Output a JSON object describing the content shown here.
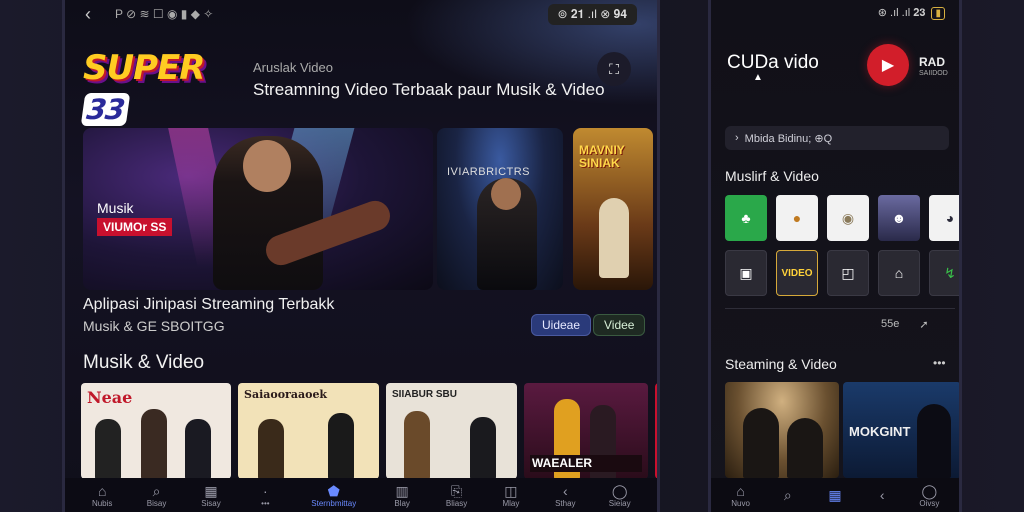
{
  "left": {
    "status": {
      "back_icon": "arrow-left-icon",
      "indicators": "P ⊘ ≋ ☐ ◉ ▮ ◆  ✧",
      "right_pill": "⊚ 𝟐𝟏 .ıl ⊗ 𝟗𝟒"
    },
    "header": {
      "logo_text": "SUPER",
      "logo_num": "33",
      "kicker": "Aruslak Video",
      "tagline": "Streamning Video Terbaak paur Musik & Video"
    },
    "hero": {
      "main_label_1": "Musik",
      "main_label_2": "VIUMOr SS",
      "side1_label": "IVIARBRICTRS",
      "side2_label": "MAVNIY SINIAK",
      "title": "Aplipasi Jinipasi Streaming Terbakk",
      "subtitle": "Musik & GE SBOITGG",
      "chip_primary": "Uideae",
      "chip_secondary": "Videe"
    },
    "section_title": "Musik & Video",
    "cards": [
      {
        "title": "Neae"
      },
      {
        "title": "Saiaooraaoek"
      },
      {
        "title": "SIIABUR SBU"
      },
      {
        "title": "WAEALER"
      },
      {
        "title": ""
      }
    ],
    "nav": [
      {
        "icon": "home-icon",
        "label": "Nubis"
      },
      {
        "icon": "search-icon",
        "label": "Bisay"
      },
      {
        "icon": "library-icon",
        "label": "Sisay"
      },
      {
        "icon": "more-icon",
        "label": "•••"
      },
      {
        "icon": "home-filled-icon",
        "label": "Sternbmittay"
      },
      {
        "icon": "store-icon",
        "label": "Blay"
      },
      {
        "icon": "bookmark-icon",
        "label": "Bliasy"
      },
      {
        "icon": "book-icon",
        "label": "Mlay"
      },
      {
        "icon": "back-icon",
        "label": "Sthay"
      },
      {
        "icon": "chat-icon",
        "label": "Sieiay"
      }
    ]
  },
  "right": {
    "status": "⊛ .ıl .ıl 𝟐𝟑",
    "battery": "▮",
    "app_title": "CUDa vido",
    "rad_label": "RAD",
    "rad_sub": "SAIIDOD",
    "search_text": "Mbida Bidinu; ⊕Q",
    "section1": "Muslirf & Video",
    "tiles_row1": [
      {
        "icon": "music-note-icon",
        "color": "#2aa84a"
      },
      {
        "icon": "mic-icon",
        "color": "#f2f2f2"
      },
      {
        "icon": "disc-icon",
        "color": "#f2f2f2"
      },
      {
        "icon": "album-art-icon",
        "color": "#3a3a5a"
      },
      {
        "icon": "avatar-icon",
        "color": "#f2f2f2"
      }
    ],
    "tiles_row2": [
      {
        "icon": "calendar-icon",
        "label": "▣"
      },
      {
        "icon": "video-badge-icon",
        "label": "VIDEO"
      },
      {
        "icon": "image-icon",
        "label": "◰"
      },
      {
        "icon": "shop-icon",
        "label": "⌂"
      },
      {
        "icon": "share-icon",
        "label": "↯"
      }
    ],
    "meta_count": "55e",
    "meta_share": "➚",
    "section2": "Steaming & Video",
    "section2_more": "•••",
    "card2_title": "MOKGINT",
    "nav": [
      {
        "icon": "home-icon",
        "label": "Nuvo"
      },
      {
        "icon": "search-icon",
        "label": ""
      },
      {
        "icon": "library-icon",
        "label": ""
      },
      {
        "icon": "back-icon",
        "label": ""
      },
      {
        "icon": "chat-icon",
        "label": "Oivsy"
      }
    ]
  }
}
